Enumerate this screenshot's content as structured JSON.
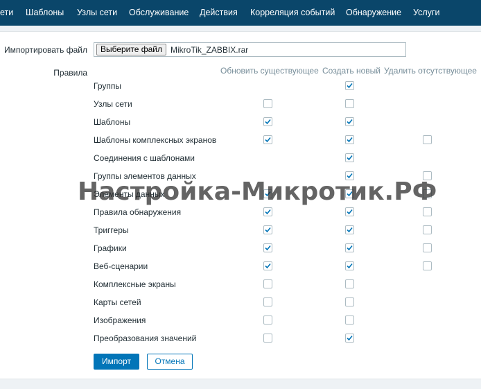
{
  "nav": {
    "items": [
      "ети",
      "Шаблоны",
      "Узлы сети",
      "Обслуживание",
      "Действия",
      "Корреляция событий",
      "Обнаружение",
      "Услуги"
    ]
  },
  "form": {
    "import_file_label": "Импортировать файл",
    "choose_file_button": "Выберите файл",
    "file_name": "MikroTik_ZABBIX.rar",
    "rules_label": "Правила",
    "columns": [
      "Обновить существующее",
      "Создать новый",
      "Удалить отсутствующее"
    ],
    "rules": [
      {
        "label": "Группы",
        "update": null,
        "create": true,
        "delete": null
      },
      {
        "label": "Узлы сети",
        "update": false,
        "create": false,
        "delete": null
      },
      {
        "label": "Шаблоны",
        "update": true,
        "create": true,
        "delete": null
      },
      {
        "label": "Шаблоны комплексных экранов",
        "update": true,
        "create": true,
        "delete": false
      },
      {
        "label": "Соединения с шаблонами",
        "update": null,
        "create": true,
        "delete": null
      },
      {
        "label": "Группы элементов данных",
        "update": null,
        "create": true,
        "delete": false
      },
      {
        "label": "Элементы данных",
        "update": true,
        "create": true,
        "delete": false
      },
      {
        "label": "Правила обнаружения",
        "update": true,
        "create": true,
        "delete": false
      },
      {
        "label": "Триггеры",
        "update": true,
        "create": true,
        "delete": false
      },
      {
        "label": "Графики",
        "update": true,
        "create": true,
        "delete": false
      },
      {
        "label": "Веб-сценарии",
        "update": true,
        "create": true,
        "delete": false
      },
      {
        "label": "Комплексные экраны",
        "update": false,
        "create": false,
        "delete": null
      },
      {
        "label": "Карты сетей",
        "update": false,
        "create": false,
        "delete": null
      },
      {
        "label": "Изображения",
        "update": false,
        "create": false,
        "delete": null
      },
      {
        "label": "Преобразования значений",
        "update": false,
        "create": true,
        "delete": null
      }
    ],
    "import_button": "Импорт",
    "cancel_button": "Отмена"
  },
  "watermark": "Настройка-Микротик.РФ",
  "colors": {
    "nav_bg": "#0a466a",
    "accent": "#0275b8",
    "column_header": "#768d99"
  }
}
